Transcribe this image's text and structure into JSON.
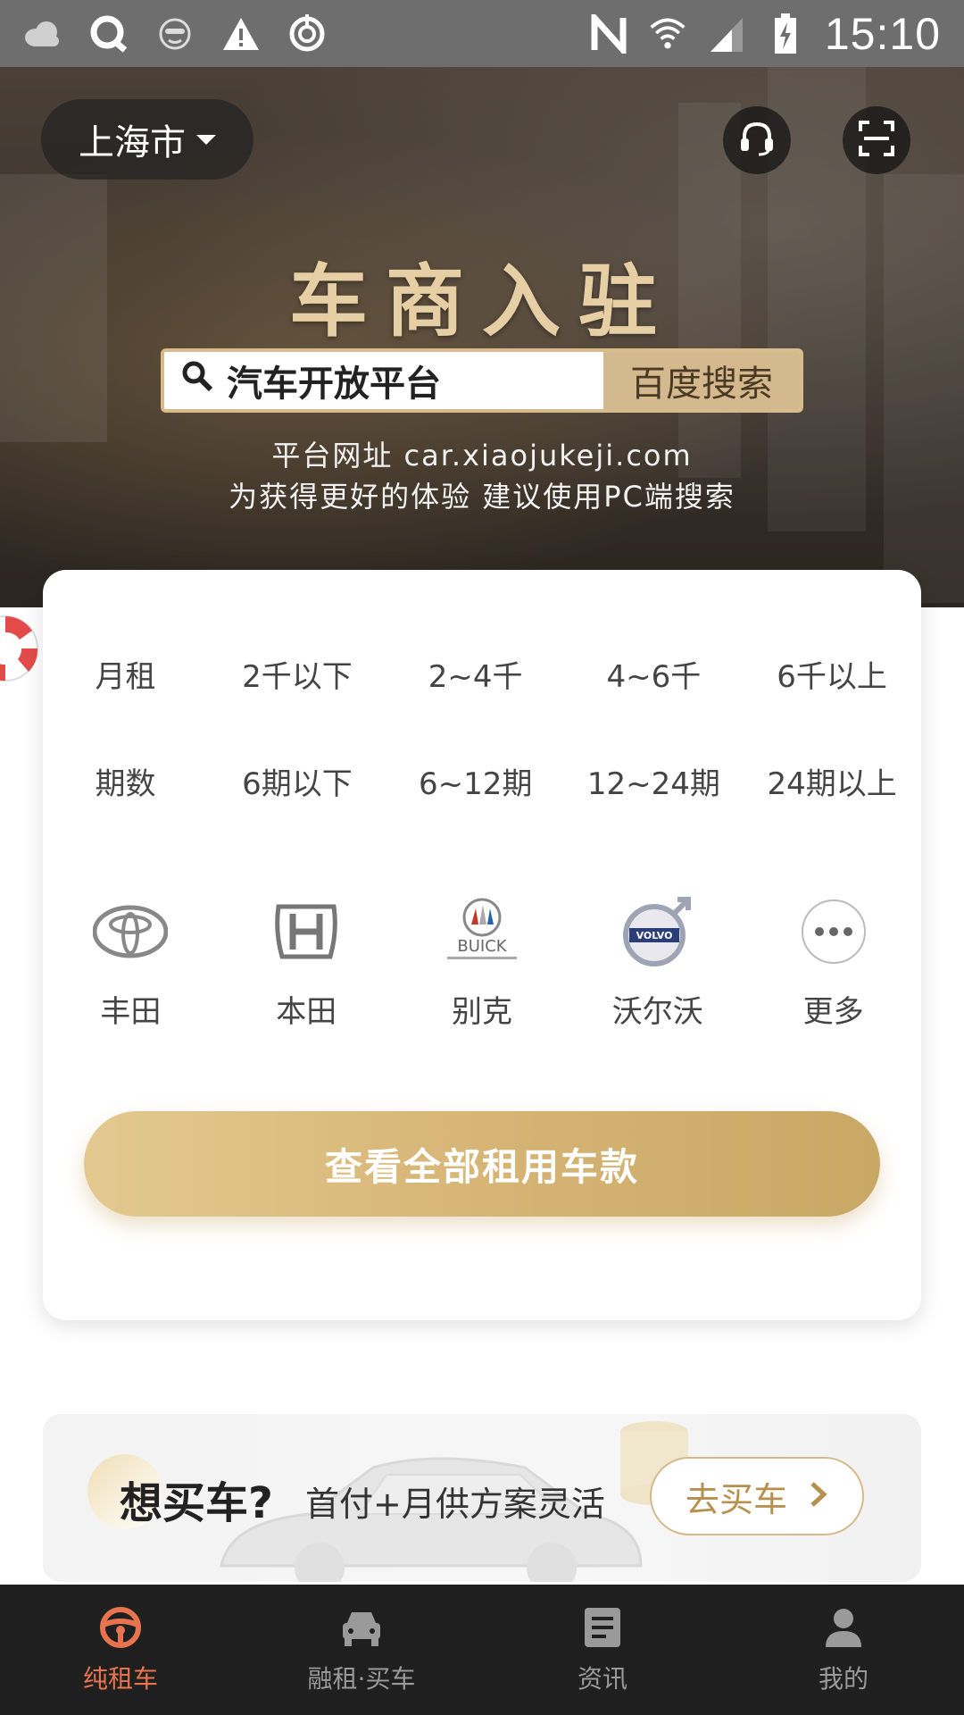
{
  "status_bar": {
    "time": "15:10",
    "left_icons": [
      "cloud-icon",
      "q-app-icon",
      "face-app-icon",
      "warning-icon",
      "sync-icon"
    ],
    "right_icons": [
      "nfc-icon",
      "wifi-icon",
      "signal-icon",
      "battery-charging-icon"
    ]
  },
  "header": {
    "city": "上海市",
    "service_icon": "headset-icon",
    "scan_icon": "scan-icon"
  },
  "banner": {
    "title": "车商入驻",
    "search_query": "汽车开放平台",
    "search_button": "百度搜索",
    "site_line": "平台网址 car.xiaojukeji.com",
    "tip_line": "为获得更好的体验 建议使用PC端搜索"
  },
  "filters": {
    "monthly_rent": {
      "label": "月租",
      "options": [
        "2千以下",
        "2~4千",
        "4~6千",
        "6千以上"
      ]
    },
    "terms": {
      "label": "期数",
      "options": [
        "6期以下",
        "6~12期",
        "12~24期",
        "24期以上"
      ]
    }
  },
  "brands": [
    {
      "name": "丰田",
      "icon": "toyota-logo"
    },
    {
      "name": "本田",
      "icon": "honda-logo"
    },
    {
      "name": "别克",
      "icon": "buick-logo"
    },
    {
      "name": "沃尔沃",
      "icon": "volvo-logo"
    },
    {
      "name": "更多",
      "icon": "more-icon"
    }
  ],
  "cta": {
    "label": "查看全部租用车款"
  },
  "buy_banner": {
    "title": "想买车?",
    "subtitle": "首付+月供方案灵活",
    "button": "去买车"
  },
  "bottom_nav": {
    "active_index": 0,
    "active_color": "#e8744f",
    "items": [
      {
        "label": "纯租车",
        "icon": "steering-wheel-icon"
      },
      {
        "label": "融租·买车",
        "icon": "car-icon"
      },
      {
        "label": "资讯",
        "icon": "news-icon"
      },
      {
        "label": "我的",
        "icon": "user-icon"
      }
    ]
  }
}
